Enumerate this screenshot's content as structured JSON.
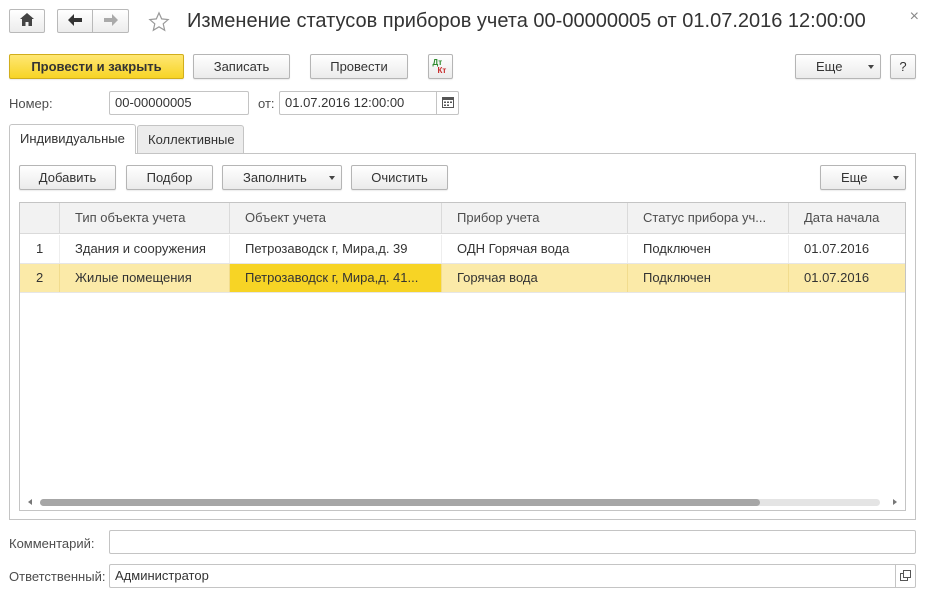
{
  "window": {
    "title": "Изменение статусов приборов учета 00-00000005 от 01.07.2016 12:00:00",
    "close_glyph": "×"
  },
  "toolbar": {
    "post_close_label": "Провести и закрыть",
    "save_label": "Записать",
    "post_label": "Провести",
    "dt_label": "Дт",
    "kt_label": "Кт",
    "more_label": "Еще",
    "help_label": "?"
  },
  "header": {
    "number_label": "Номер:",
    "number_value": "00-00000005",
    "date_label": "от:",
    "date_value": "01.07.2016 12:00:00"
  },
  "tabs": [
    {
      "label": "Индивидуальные"
    },
    {
      "label": "Коллективные"
    }
  ],
  "table_toolbar": {
    "add_label": "Добавить",
    "pick_label": "Подбор",
    "fill_label": "Заполнить",
    "clear_label": "Очистить",
    "more_label": "Еще"
  },
  "grid": {
    "columns": [
      {
        "label": ""
      },
      {
        "label": "Тип объекта учета"
      },
      {
        "label": "Объект учета"
      },
      {
        "label": "Прибор учета"
      },
      {
        "label": "Статус прибора уч..."
      },
      {
        "label": "Дата начала"
      }
    ],
    "rows": [
      {
        "n": "1",
        "type": "Здания и сооружения",
        "object": "Петрозаводск г, Мира,д. 39",
        "meter": "ОДН Горячая вода",
        "status": "Подключен",
        "date": "01.07.2016"
      },
      {
        "n": "2",
        "type": "Жилые помещения",
        "object": "Петрозаводск г, Мира,д. 41...",
        "meter": "Горячая вода",
        "status": "Подключен",
        "date": "01.07.2016"
      }
    ]
  },
  "footer": {
    "comment_label": "Комментарий:",
    "comment_value": "",
    "responsible_label": "Ответственный:",
    "responsible_value": "Администратор"
  },
  "colors": {
    "primary": "#f7d425",
    "selected_row": "#fbeaa8"
  }
}
